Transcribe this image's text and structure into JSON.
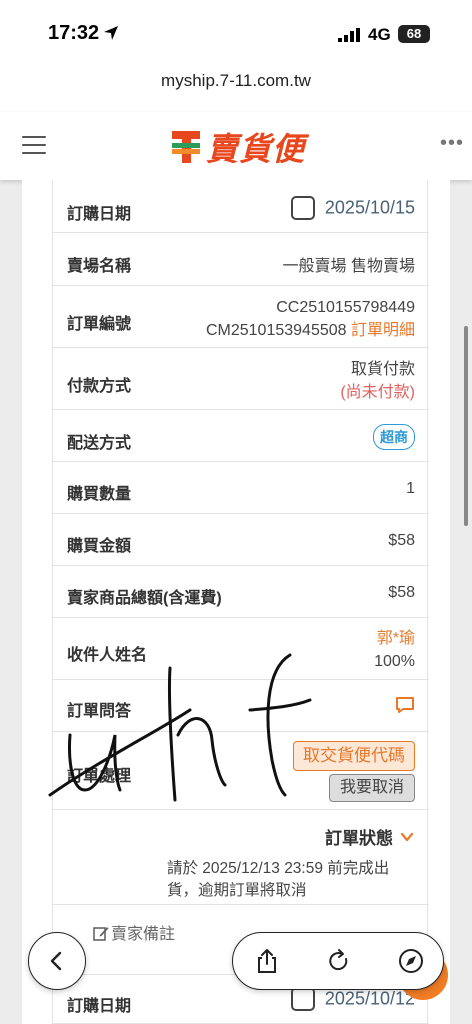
{
  "status_bar": {
    "time": "17:32",
    "network": "4G",
    "battery": "68"
  },
  "browser": {
    "url": "myship.7-11.com.tw"
  },
  "header": {
    "logo_text": "賣貨便",
    "logo_brand": "ELEVEN"
  },
  "order": {
    "rows": [
      {
        "label": "訂購日期",
        "value": "2025/10/15"
      },
      {
        "label": "賣場名稱",
        "value": "一般賣場 售物賣場"
      },
      {
        "label": "訂單編號",
        "value_line1": "CC2510155798449",
        "value_line2": "CM2510153945508",
        "link": "訂單明細"
      },
      {
        "label": "付款方式",
        "value_line1": "取貨付款",
        "value_line2": "(尚未付款)"
      },
      {
        "label": "配送方式",
        "badge": "超商"
      },
      {
        "label": "購買數量",
        "value": "1"
      },
      {
        "label": "購買金額",
        "value": "$58"
      },
      {
        "label": "賣家商品總額(含運費)",
        "value": "$58"
      },
      {
        "label": "收件人姓名",
        "value_line1": "郭*瑜",
        "value_line2": "100%"
      },
      {
        "label": "訂單問答"
      },
      {
        "label": "訂單處理"
      }
    ],
    "btn_pickup_code": "取交貨便代碼",
    "btn_cancel": "我要取消",
    "status_title": "訂單狀態",
    "status_note": "請於 2025/12/13 23:59 前完成出貨，逾期訂單將取消",
    "seller_note": "賣家備註",
    "next_row_label": "訂購日期",
    "next_row_value": "2025/10/12"
  },
  "colors": {
    "accent": "#e8782a",
    "blue": "#2b9ad6",
    "brand_red": "#e8461d"
  }
}
